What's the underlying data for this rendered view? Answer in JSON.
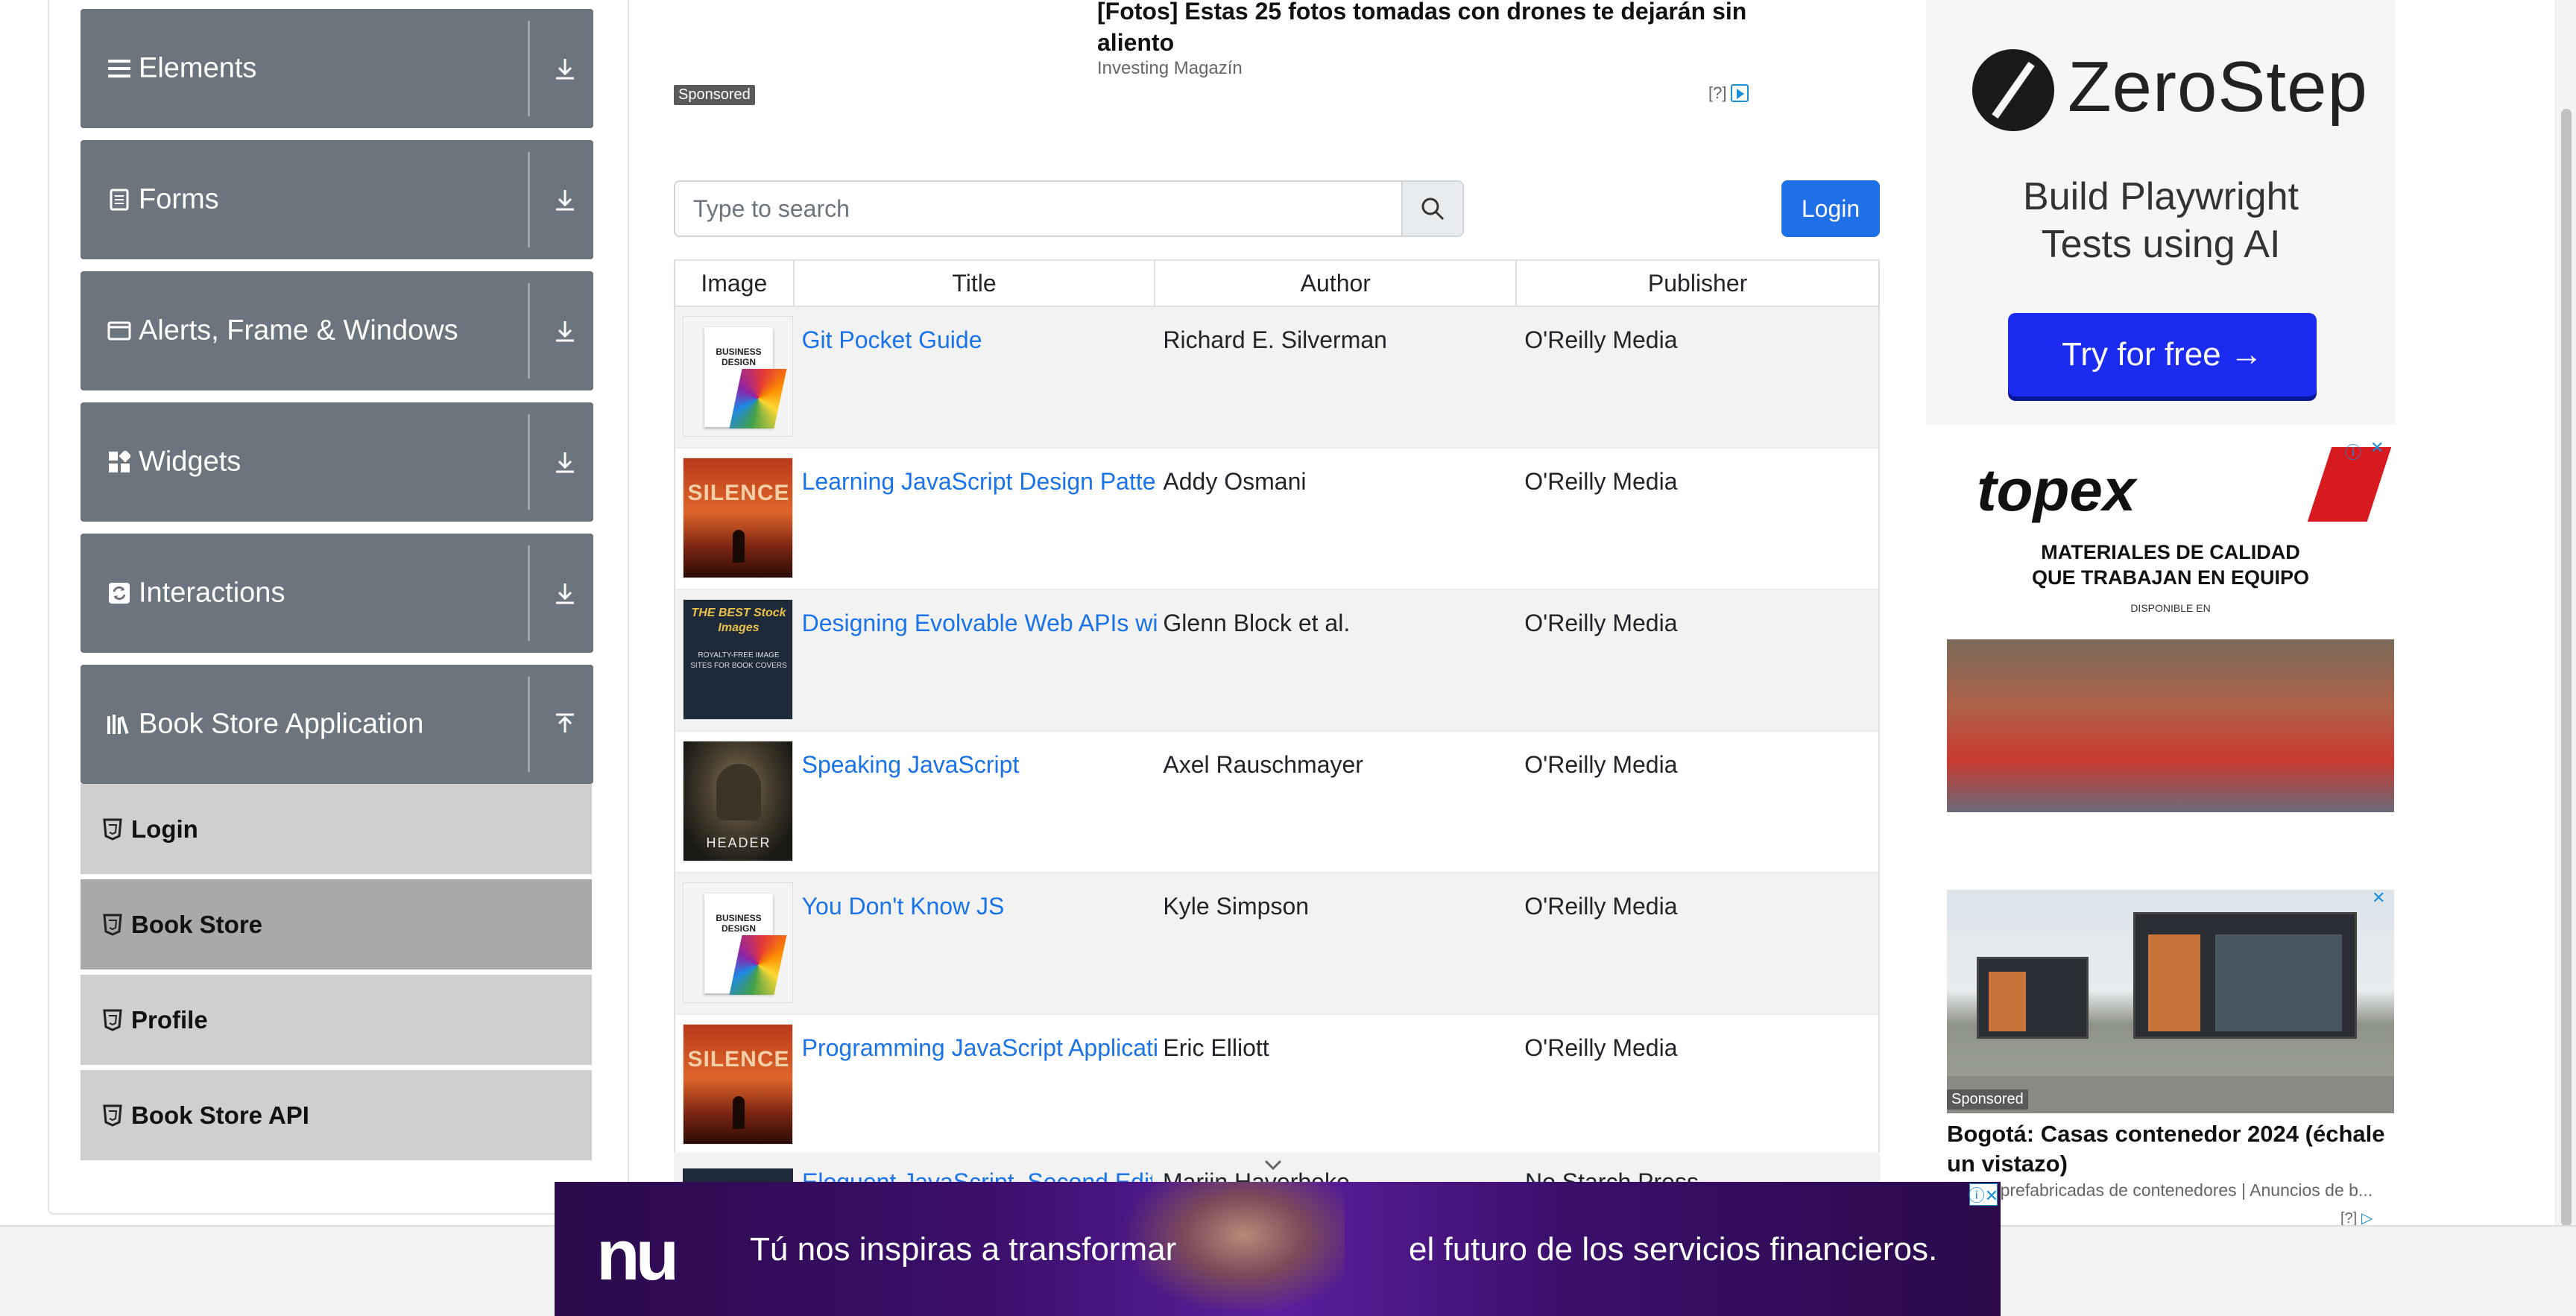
{
  "sidebar": {
    "groups": [
      {
        "label": "Elements",
        "icon": "list-icon"
      },
      {
        "label": "Forms",
        "icon": "document-icon"
      },
      {
        "label": "Alerts, Frame & Windows",
        "icon": "window-icon"
      },
      {
        "label": "Widgets",
        "icon": "grid-icon"
      },
      {
        "label": "Interactions",
        "icon": "refresh-icon"
      },
      {
        "label": "Book Store Application",
        "icon": "books-icon"
      }
    ],
    "book_store_items": [
      {
        "label": "Login"
      },
      {
        "label": "Book Store"
      },
      {
        "label": "Profile"
      },
      {
        "label": "Book Store API"
      }
    ]
  },
  "top_ad": {
    "title": "[Fotos] Estas 25 fotos tomadas con drones te dejarán sin aliento",
    "source": "Investing Magazín",
    "sponsored": "Sponsored",
    "adchoices": "[?]"
  },
  "search": {
    "placeholder": "Type to search"
  },
  "login_button": "Login",
  "table": {
    "headers": [
      "Image",
      "Title",
      "Author",
      "Publisher"
    ],
    "rows": [
      {
        "title": "Git Pocket Guide",
        "author": "Richard E. Silverman",
        "publisher": "O'Reilly Media",
        "cover": "business-design-cover"
      },
      {
        "title": "Learning JavaScript Design Patterns",
        "author": "Addy Osmani",
        "publisher": "O'Reilly Media",
        "cover": "silence-cover"
      },
      {
        "title": "Designing Evolvable Web APIs with ASP.NET",
        "author": "Glenn Block et al.",
        "publisher": "O'Reilly Media",
        "cover": "stock-images-cover"
      },
      {
        "title": "Speaking JavaScript",
        "author": "Axel Rauschmayer",
        "publisher": "O'Reilly Media",
        "cover": "header-cover"
      },
      {
        "title": "You Don't Know JS",
        "author": "Kyle Simpson",
        "publisher": "O'Reilly Media",
        "cover": "business-design-cover"
      },
      {
        "title": "Programming JavaScript Applications",
        "author": "Eric Elliott",
        "publisher": "O'Reilly Media",
        "cover": "silence-cover"
      }
    ],
    "partial_row": {
      "title": "Eloquent JavaScript, Second Edition",
      "author": "Marijn Haverbeke",
      "publisher": "No Starch Press"
    }
  },
  "covers": {
    "business_title": "BUSINESS DESIGN",
    "silence_title": "SILENCE",
    "stock_title": "THE BEST Stock Images",
    "stock_sub": "ROYALTY-FREE IMAGE SITES FOR BOOK COVERS",
    "header_title": "HEADER"
  },
  "right_ads": {
    "zerostep": {
      "name": "ZeroStep",
      "tagline_1": "Build Playwright",
      "tagline_2": "Tests using AI",
      "button": "Try for free →"
    },
    "topex": {
      "name": "topex",
      "slogan_1": "MATERIALES DE CALIDAD",
      "slogan_2": "QUE TRABAJAN EN EQUIPO",
      "dispo": "DISPONIBLE EN"
    },
    "casas": {
      "sponsored": "Sponsored",
      "title": "Bogotá: Casas contenedor 2024 (échale un vistazo)",
      "source": "Casas prefabricadas de contenedores | Anuncios de b...",
      "adchoices": "[?]"
    }
  },
  "bottom_banner": {
    "logo": "nu",
    "left_text": "Tú nos inspiras a transformar",
    "right_text": "el futuro de los servicios financieros."
  },
  "colors": {
    "sidebar_group": "#6c757d",
    "link": "#1a73e8",
    "primary_button": "#1e6fe8",
    "zerostep_button": "#1b2cf0",
    "banner": "#3b0f6b"
  }
}
